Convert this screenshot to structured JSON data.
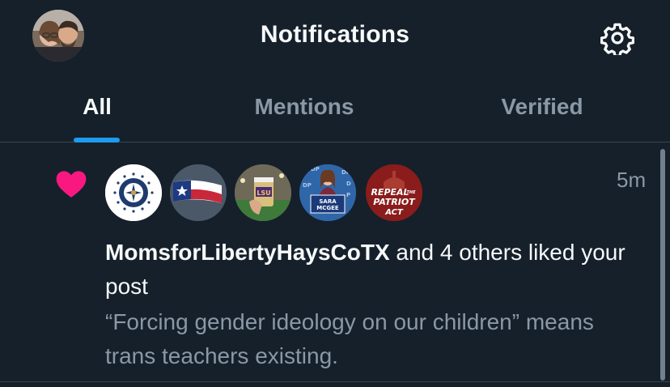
{
  "header": {
    "title": "Notifications",
    "profile_avatar": "profile-photo",
    "settings_icon": "gear-icon"
  },
  "tabs": [
    {
      "label": "All",
      "active": true
    },
    {
      "label": "Mentions",
      "active": false
    },
    {
      "label": "Verified",
      "active": false
    }
  ],
  "notification": {
    "type_icon": "heart-icon",
    "time": "5m",
    "user": "MomsforLibertyHaysCoTX",
    "action": " and 4 others liked your post",
    "preview": "“Forcing gender ideology on our children” means trans teachers existing.",
    "avatars": [
      {
        "name": "moms-for-liberty-logo"
      },
      {
        "name": "texas-flag-avatar"
      },
      {
        "name": "lsu-cup-avatar"
      },
      {
        "name": "sara-mcgee-avatar",
        "sign_text_1": "SARA",
        "sign_text_2": "MCGEE"
      },
      {
        "name": "repeal-patriot-act-avatar",
        "line1": "REPEAL",
        "line1b": "THE",
        "line2": "PATRIOT",
        "line3": "ACT"
      }
    ]
  },
  "colors": {
    "background": "#15202b",
    "accent": "#1d9bf0",
    "heart": "#f91880",
    "muted": "#8b98a5",
    "divider": "#38444d"
  }
}
